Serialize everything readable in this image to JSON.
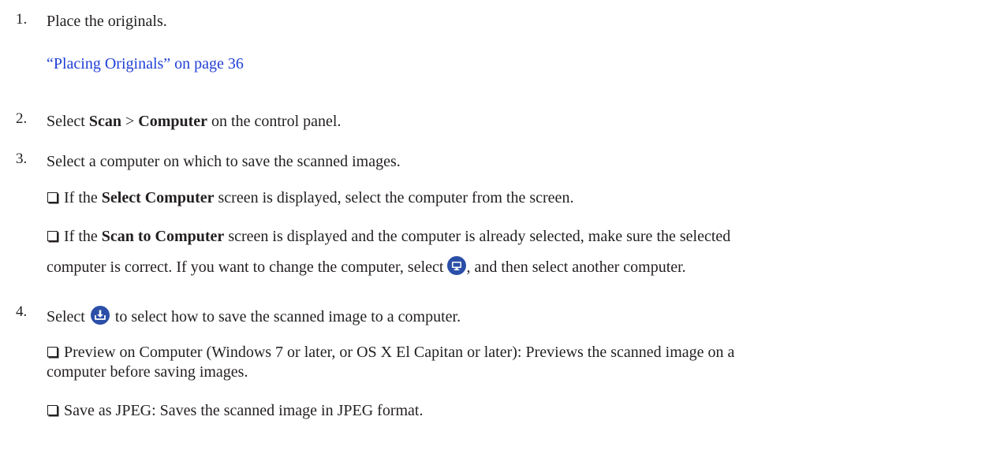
{
  "steps": [
    {
      "number": "1.",
      "text": "Place the originals.",
      "link": "“Placing Originals” on page 36"
    },
    {
      "number": "2.",
      "pre": "Select ",
      "bold1": "Scan",
      "mid": " > ",
      "bold2": "Computer",
      "post": " on the control panel."
    },
    {
      "number": "3.",
      "text": "Select a computer on which to save the scanned images.",
      "bullets": [
        {
          "pre": "If the ",
          "bold": "Select Computer",
          "post": " screen is displayed, select the computer from the screen."
        },
        {
          "pre": "If the ",
          "bold": "Scan to Computer",
          "post": " screen is displayed and the computer is already selected, make sure the selected",
          "line2_pre": "computer is correct. If you want to change the computer, select ",
          "line2_post": ", and then select another computer.",
          "icon": "computer-icon"
        }
      ]
    },
    {
      "number": "4.",
      "pre": "Select ",
      "post": " to select how to save the scanned image to a computer.",
      "icon": "save-download-icon",
      "bullets": [
        {
          "line1": "Preview on Computer (Windows 7 or later, or OS X El Capitan or later): Previews the scanned image on a",
          "line2": "computer before saving images."
        },
        {
          "line1": "Save as JPEG: Saves the scanned image in JPEG format."
        }
      ]
    }
  ],
  "colors": {
    "text": "#231f20",
    "link": "#1f3fd6",
    "icon": "#2b4fa8"
  }
}
